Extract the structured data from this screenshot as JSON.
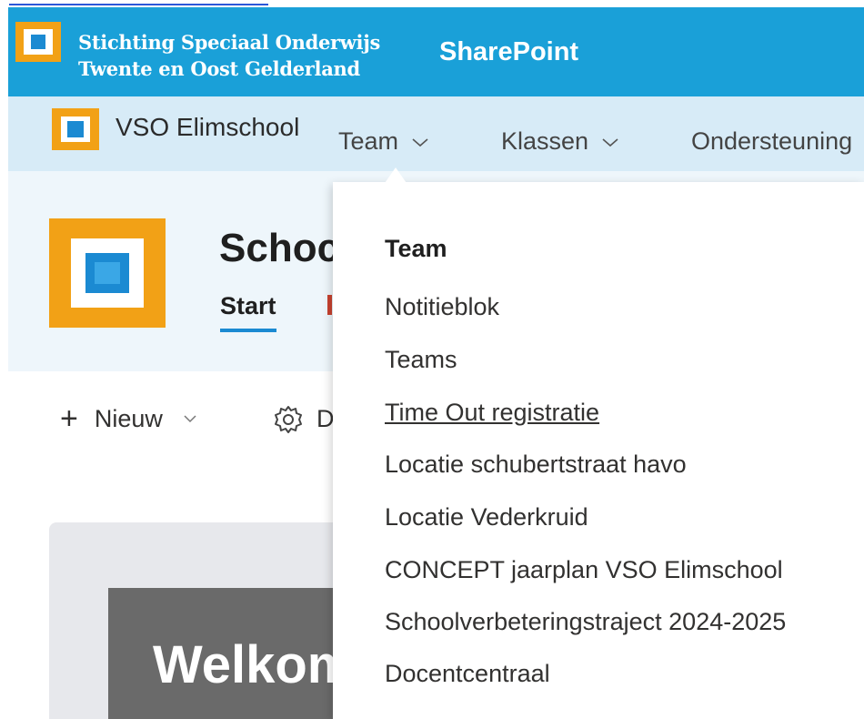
{
  "suite": {
    "org_name_line1": "Stichting Speciaal Onderwijs",
    "org_name_line2": "Twente en Oost Gelderland",
    "app_name": "SharePoint",
    "colors": {
      "suite_bar": "#1aa0d8",
      "hub_nav": "#d7ebf7",
      "logo_orange": "#f2a116",
      "logo_blue": "#1b8ad2"
    }
  },
  "hub": {
    "site_title": "VSO Elimschool",
    "items": [
      {
        "label": "Team",
        "has_dropdown": true,
        "expanded": true
      },
      {
        "label": "Klassen",
        "has_dropdown": true
      },
      {
        "label": "Ondersteuning"
      }
    ]
  },
  "site": {
    "title": "Schoc",
    "tabs": [
      {
        "label": "Start",
        "active": true
      }
    ]
  },
  "command_bar": {
    "new_label": "Nieuw",
    "gear_label_fragment": "D"
  },
  "hero": {
    "text": "Welkom"
  },
  "mega_menu": {
    "heading": "Team",
    "links": [
      {
        "label": "Notitieblok"
      },
      {
        "label": "Teams"
      },
      {
        "label": "Time Out registratie",
        "hovered": true
      },
      {
        "label": "Locatie schubertstraat havo"
      },
      {
        "label": "Locatie Vederkruid"
      },
      {
        "label": "CONCEPT jaarplan VSO Elimschool"
      },
      {
        "label": "Schoolverbeteringstraject 2024-2025"
      },
      {
        "label": "Docentcentraal"
      }
    ]
  }
}
